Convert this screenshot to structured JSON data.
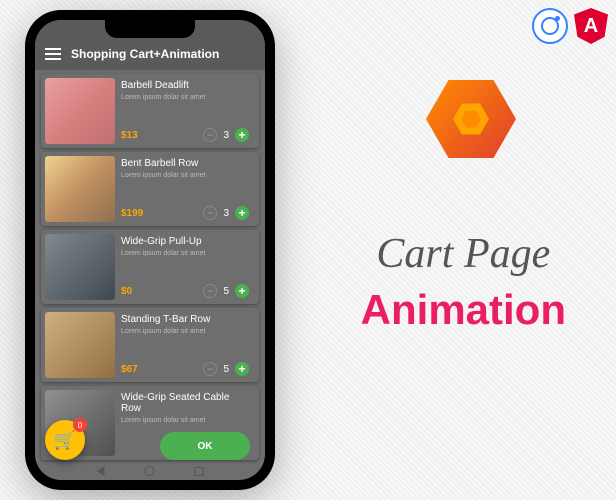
{
  "header": {
    "title": "Shopping Cart+Animation"
  },
  "items": [
    {
      "title": "Barbell Deadlift",
      "desc": "Lorem ipsum dolar sit amet",
      "price": "$13",
      "qty": "3"
    },
    {
      "title": "Bent Barbell Row",
      "desc": "Lorem ipsum dolar sit amet",
      "price": "$199",
      "qty": "3"
    },
    {
      "title": "Wide-Grip Pull-Up",
      "desc": "Lorem ipsum dolar sit amet",
      "price": "$0",
      "qty": "5"
    },
    {
      "title": "Standing T-Bar Row",
      "desc": "Lorem ipsum dolar sit amet",
      "price": "$67",
      "qty": "5"
    },
    {
      "title": "Wide-Grip Seated Cable Row",
      "desc": "Lorem ipsum dolar sit amet",
      "price": "",
      "qty": ""
    }
  ],
  "fab": {
    "badge": "0"
  },
  "okButton": {
    "label": "OK"
  },
  "promo": {
    "line1": "Cart Page",
    "line2": "Animation"
  }
}
